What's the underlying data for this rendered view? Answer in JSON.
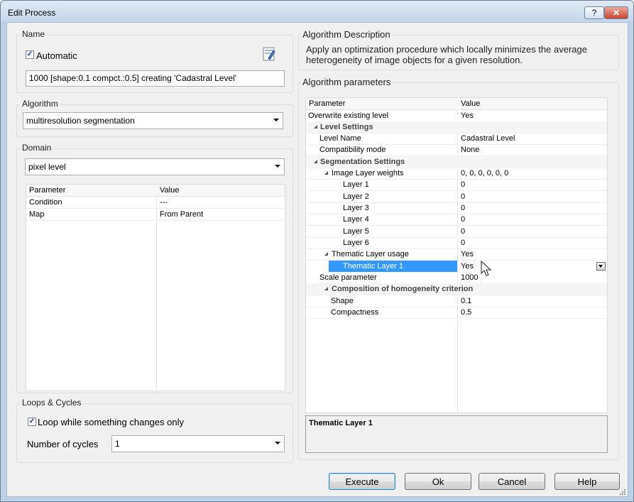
{
  "window": {
    "title": "Edit Process",
    "help_glyph": "?",
    "close_glyph": "✕"
  },
  "name_group": {
    "title": "Name",
    "automatic_label": "Automatic",
    "automatic_checked": true,
    "name_value": "1000 [shape:0.1 compct.:0.5] creating 'Cadastral Level'"
  },
  "algorithm_group": {
    "title": "Algorithm",
    "selected": "multiresolution segmentation"
  },
  "domain_group": {
    "title": "Domain",
    "selected": "pixel level",
    "columns": [
      "Parameter",
      "Value"
    ],
    "rows": [
      {
        "param": "Condition",
        "value": "---"
      },
      {
        "param": "Map",
        "value": "From Parent"
      }
    ]
  },
  "loops_group": {
    "title": "Loops & Cycles",
    "loop_label": "Loop while something changes only",
    "loop_checked": true,
    "cycles_label": "Number of cycles",
    "cycles_value": "1"
  },
  "description_group": {
    "title": "Algorithm Description",
    "text": "Apply an optimization procedure which locally minimizes the average heterogeneity of image objects for a given resolution."
  },
  "params_group": {
    "title": "Algorithm parameters",
    "columns": [
      "Parameter",
      "Value"
    ],
    "rows": [
      {
        "param": "Overwrite existing level",
        "value": "Yes"
      },
      {
        "param": "Level Settings",
        "value": ""
      },
      {
        "param": "Level Name",
        "value": "Cadastral Level"
      },
      {
        "param": "Compatibility mode",
        "value": "None"
      },
      {
        "param": "Segmentation Settings",
        "value": ""
      },
      {
        "param": "Image Layer weights",
        "value": "0, 0, 0, 0, 0, 0"
      },
      {
        "param": "Layer 1",
        "value": "0"
      },
      {
        "param": "Layer 2",
        "value": "0"
      },
      {
        "param": "Layer 3",
        "value": "0"
      },
      {
        "param": "Layer 4",
        "value": "0"
      },
      {
        "param": "Layer 5",
        "value": "0"
      },
      {
        "param": "Layer 6",
        "value": "0"
      },
      {
        "param": "Thematic Layer usage",
        "value": "Yes"
      },
      {
        "param": "Thematic Layer 1",
        "value": "Yes"
      },
      {
        "param": "Scale parameter",
        "value": "1000"
      },
      {
        "param": "Composition of homogeneity criterion",
        "value": ""
      },
      {
        "param": "Shape",
        "value": "0.1"
      },
      {
        "param": "Compactness",
        "value": "0.5"
      }
    ],
    "help_title": "Thematic Layer 1"
  },
  "buttons": {
    "execute": "Execute",
    "ok": "Ok",
    "cancel": "Cancel",
    "help": "Help"
  },
  "colors": {
    "selection": "#3399ff",
    "window_frame": "#bcd0e6"
  }
}
